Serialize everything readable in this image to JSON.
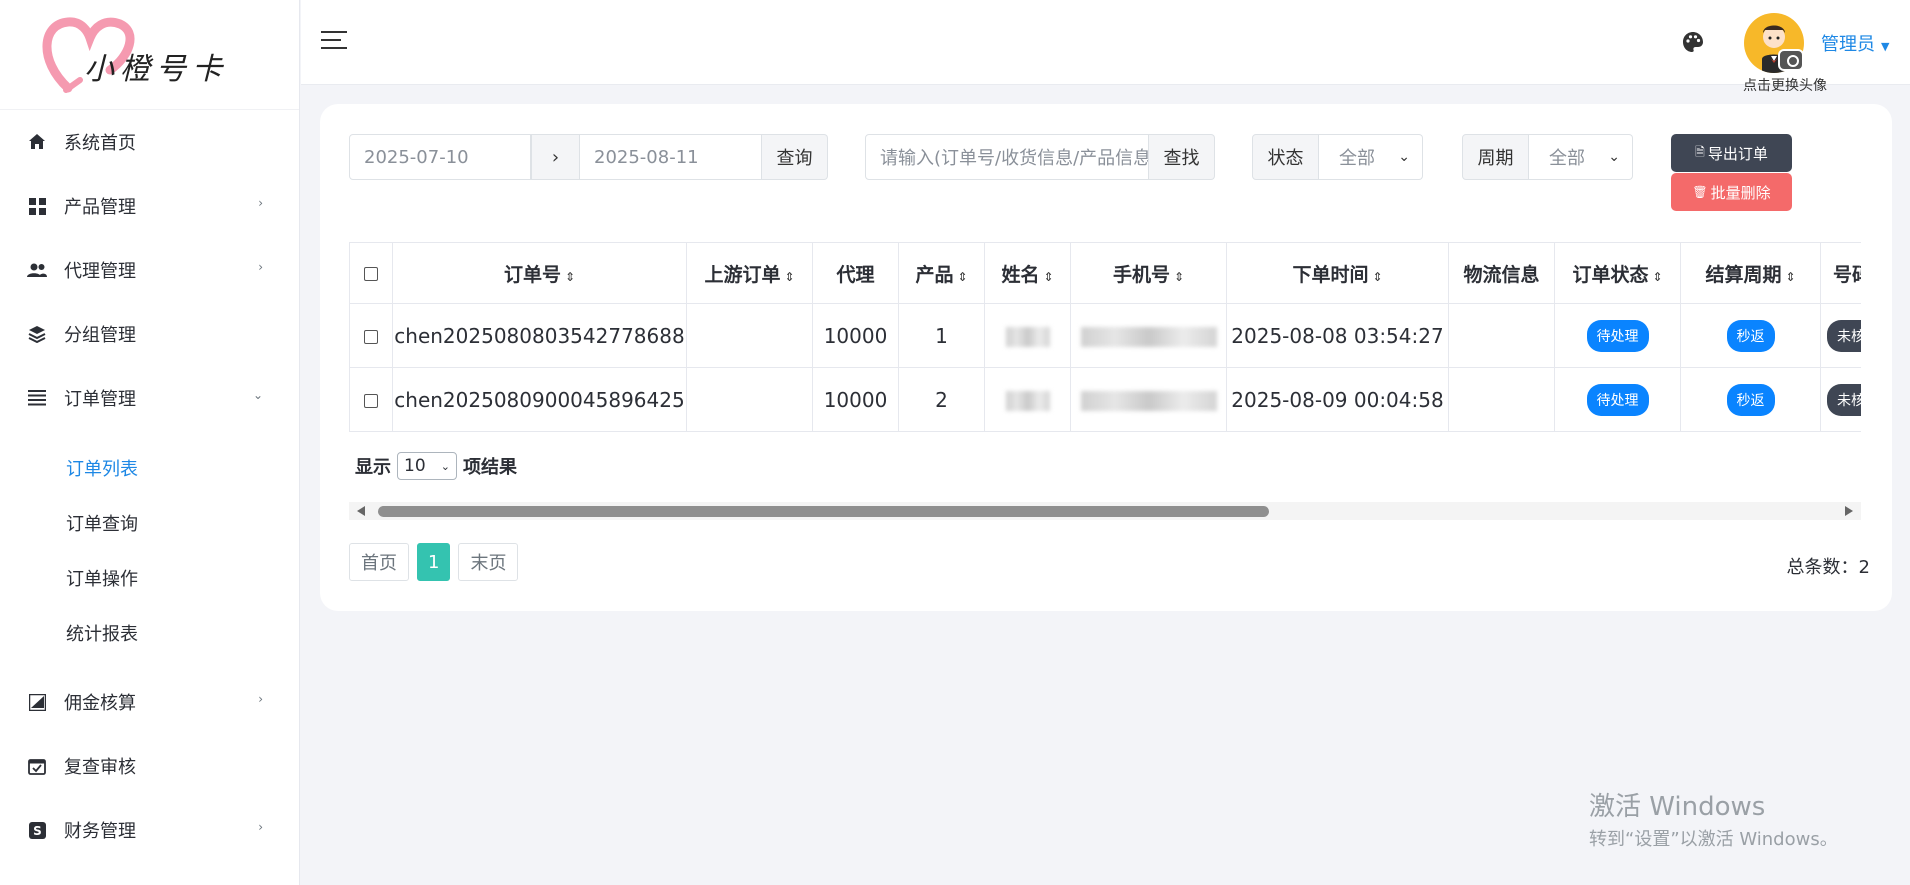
{
  "brand": {
    "name": "小橙号卡"
  },
  "sidebar": {
    "items": [
      {
        "label": "系统首页",
        "icon": "home-icon",
        "has_arrow": false
      },
      {
        "label": "产品管理",
        "icon": "grid-icon",
        "has_arrow": true
      },
      {
        "label": "代理管理",
        "icon": "users-icon",
        "has_arrow": true
      },
      {
        "label": "分组管理",
        "icon": "layers-icon",
        "has_arrow": false
      },
      {
        "label": "订单管理",
        "icon": "list-icon",
        "has_arrow": true,
        "expanded": true
      }
    ],
    "sub_items": [
      {
        "label": "订单列表",
        "active": true
      },
      {
        "label": "订单查询"
      },
      {
        "label": "订单操作"
      },
      {
        "label": "统计报表"
      }
    ],
    "items_after": [
      {
        "label": "佣金核算",
        "icon": "chart-icon",
        "has_arrow": true
      },
      {
        "label": "复查审核",
        "icon": "calendar-check-icon",
        "has_arrow": false
      },
      {
        "label": "财务管理",
        "icon": "dollar-icon",
        "has_arrow": true
      }
    ]
  },
  "header": {
    "menu_icon": "hamburger-icon",
    "theme_icon": "palette-icon",
    "avatar_hint": "点击更换头像",
    "user_name": "管理员"
  },
  "filters": {
    "date_from": "2025-07-10",
    "date_sep": "›",
    "date_to": "2025-08-11",
    "query_label": "查询",
    "search_placeholder": "请输入(订单号/收货信息/产品信息",
    "search_label": "查找",
    "status_label": "状态",
    "status_value": "全部",
    "period_label": "周期",
    "period_value": "全部",
    "export_label": "导出订单",
    "delete_label": "批量删除"
  },
  "table": {
    "columns": [
      "订单号",
      "上游订单",
      "代理",
      "产品",
      "姓名",
      "手机号",
      "下单时间",
      "物流信息",
      "订单状态",
      "结算周期",
      "号码"
    ],
    "rows": [
      {
        "order_no": "chen2025080803542778688",
        "upstream": "",
        "agent": "10000",
        "product": "1",
        "time": "2025-08-08 03:54:27",
        "logistics": "",
        "status": "待处理",
        "cycle": "秒返",
        "number": "未核实"
      },
      {
        "order_no": "chen2025080900045896425",
        "upstream": "",
        "agent": "10000",
        "product": "2",
        "time": "2025-08-09 00:04:58",
        "logistics": "",
        "status": "待处理",
        "cycle": "秒返",
        "number": "未核实"
      }
    ]
  },
  "paging": {
    "show_label": "显示",
    "page_length": "10",
    "results_label": "项结果",
    "first": "首页",
    "current": "1",
    "last": "末页",
    "total_text": "总条数：2"
  },
  "watermark": {
    "line1": "激活 Windows",
    "line2": "转到“设置”以激活 Windows。"
  },
  "colors": {
    "accent": "#1e88e5",
    "badge_blue": "#0a84ff",
    "dark_button": "#3f4654",
    "danger": "#f46a6a",
    "page_active": "#34c3b0"
  }
}
